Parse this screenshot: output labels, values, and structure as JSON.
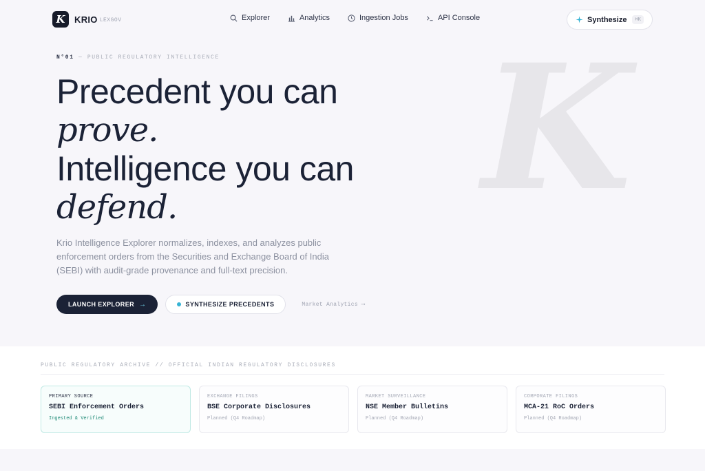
{
  "brand": {
    "logo_letter": "K",
    "name": "KRIO",
    "sub": "LEXGOV"
  },
  "nav": {
    "links": [
      {
        "label": "Explorer",
        "icon": "search-icon"
      },
      {
        "label": "Analytics",
        "icon": "bar-chart-icon"
      },
      {
        "label": "Ingestion Jobs",
        "icon": "clock-icon"
      },
      {
        "label": "API Console",
        "icon": "terminal-icon"
      }
    ],
    "synthesize": {
      "label": "Synthesize",
      "shortcut": "⌘K",
      "icon": "sparkle-icon"
    }
  },
  "hero": {
    "watermark": "K",
    "eyebrow_num": "N°01",
    "eyebrow_text": "— PUBLIC REGULATORY INTELLIGENCE",
    "line1": "Precedent you can",
    "line2": "prove.",
    "line3": "Intelligence you can",
    "line4": "defend.",
    "lede": "Krio Intelligence Explorer normalizes, indexes, and analyzes public enforcement orders from the Securities and Exchange Board of India (SEBI) with audit-grade provenance and full-text precision.",
    "cta_primary": "LAUNCH EXPLORER",
    "cta_primary_arrow": "→",
    "cta_secondary": "SYNTHESIZE PRECEDENTS",
    "cta_link": "Market Analytics ⟶"
  },
  "archive": {
    "heading": "PUBLIC REGULATORY ARCHIVE // OFFICIAL INDIAN REGULATORY DISCLOSURES",
    "cards": [
      {
        "kicker": "PRIMARY SOURCE",
        "title": "SEBI Enforcement Orders",
        "status": "Ingested & Verified"
      },
      {
        "kicker": "EXCHANGE FILINGS",
        "title": "BSE Corporate Disclosures",
        "status": "Planned (Q4 Roadmap)"
      },
      {
        "kicker": "MARKET SURVEILLANCE",
        "title": "NSE Member Bulletins",
        "status": "Planned (Q4 Roadmap)"
      },
      {
        "kicker": "CORPORATE FILINGS",
        "title": "MCA-21 RoC Orders",
        "status": "Planned (Q4 Roadmap)"
      }
    ]
  },
  "colors": {
    "accent": "#36b3d4",
    "primary_dark": "#1b2236",
    "verified": "#1f8a76"
  }
}
